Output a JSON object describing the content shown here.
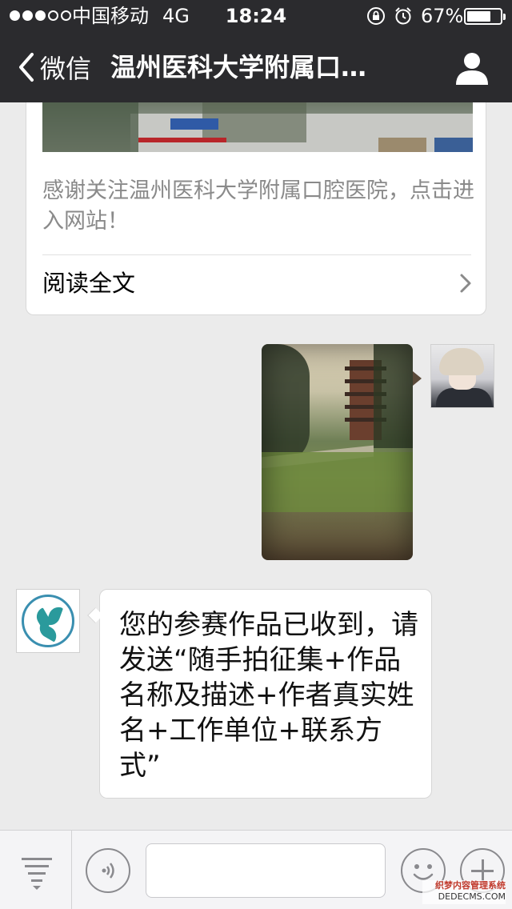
{
  "status_bar": {
    "carrier": "中国移动",
    "network": "4G",
    "time": "18:24",
    "battery_percent": "67%",
    "signal_strength_dots": 3,
    "signal_total_dots": 5,
    "battery_level": 0.67
  },
  "nav": {
    "back_label": "微信",
    "title": "温州医科大学附属口…",
    "back_icon": "chevron-left-icon",
    "profile_icon": "person-icon"
  },
  "article": {
    "description": "感谢关注温州医科大学附属口腔医院，点击进入网站！",
    "read_full_label": "阅读全文"
  },
  "messages": {
    "received_text": "您的参赛作品已收到，请发送“随手拍征集+作品名称及描述+作者真实姓名+工作单位+联系方式”"
  },
  "toolbar": {
    "menu_icon": "menu-icon",
    "voice_icon": "voice-icon",
    "input_value": "",
    "emoji_icon": "emoji-icon",
    "plus_icon": "plus-icon"
  },
  "watermark": {
    "line1": "织梦内容管理系统",
    "line2": "DEDECMS.COM"
  },
  "colors": {
    "nav_background": "#2b2b2e",
    "chat_background": "#ebebeb",
    "bubble_background": "#ffffff"
  }
}
